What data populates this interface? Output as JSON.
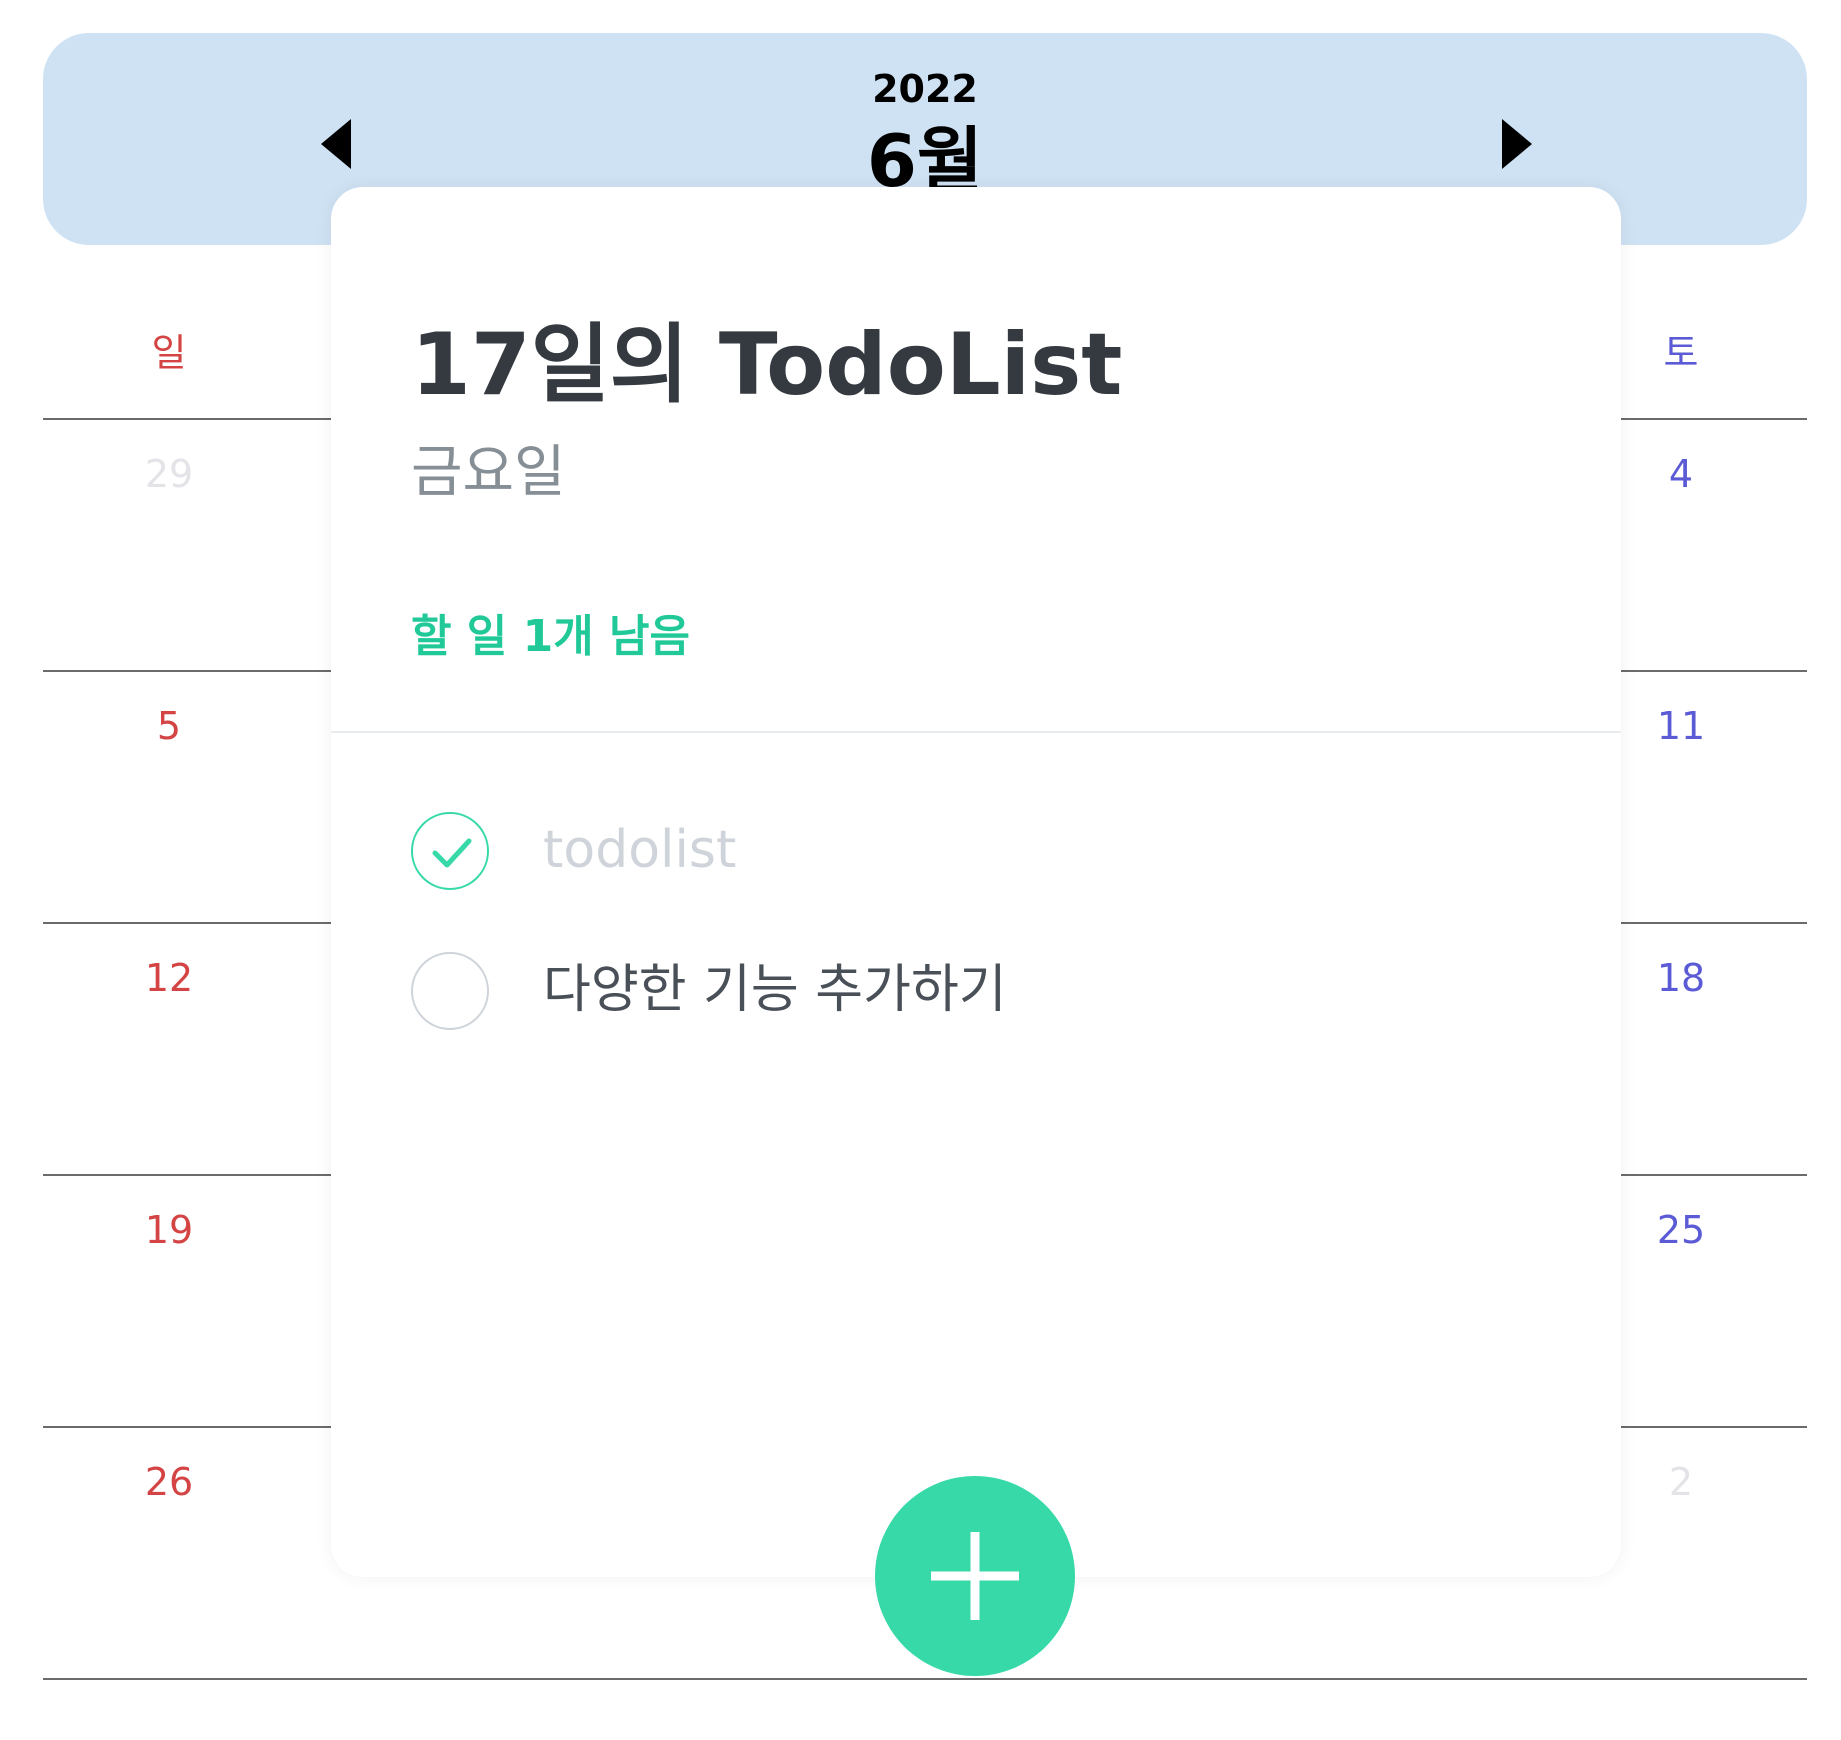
{
  "header": {
    "year": "2022",
    "month": "6월",
    "bg_color": "#cfe2f3"
  },
  "weekdays": {
    "sunday": "일",
    "saturday": "토"
  },
  "calendar": {
    "sunday_dates": [
      "29",
      "5",
      "12",
      "19",
      "26"
    ],
    "saturday_dates": [
      "4",
      "11",
      "18",
      "25",
      "2"
    ]
  },
  "modal": {
    "title": "17일의 TodoList",
    "weekday": "금요일",
    "remaining": "할 일 1개 남음",
    "todos": [
      {
        "text": "todolist",
        "done": true
      },
      {
        "text": "다양한 기능 추가하기",
        "done": false
      }
    ]
  },
  "colors": {
    "accent": "#38d9a9",
    "remaining_text": "#20c997",
    "sunday": "#d44444",
    "saturday": "#5b5bd6",
    "muted_date": "#e4e4e8"
  }
}
